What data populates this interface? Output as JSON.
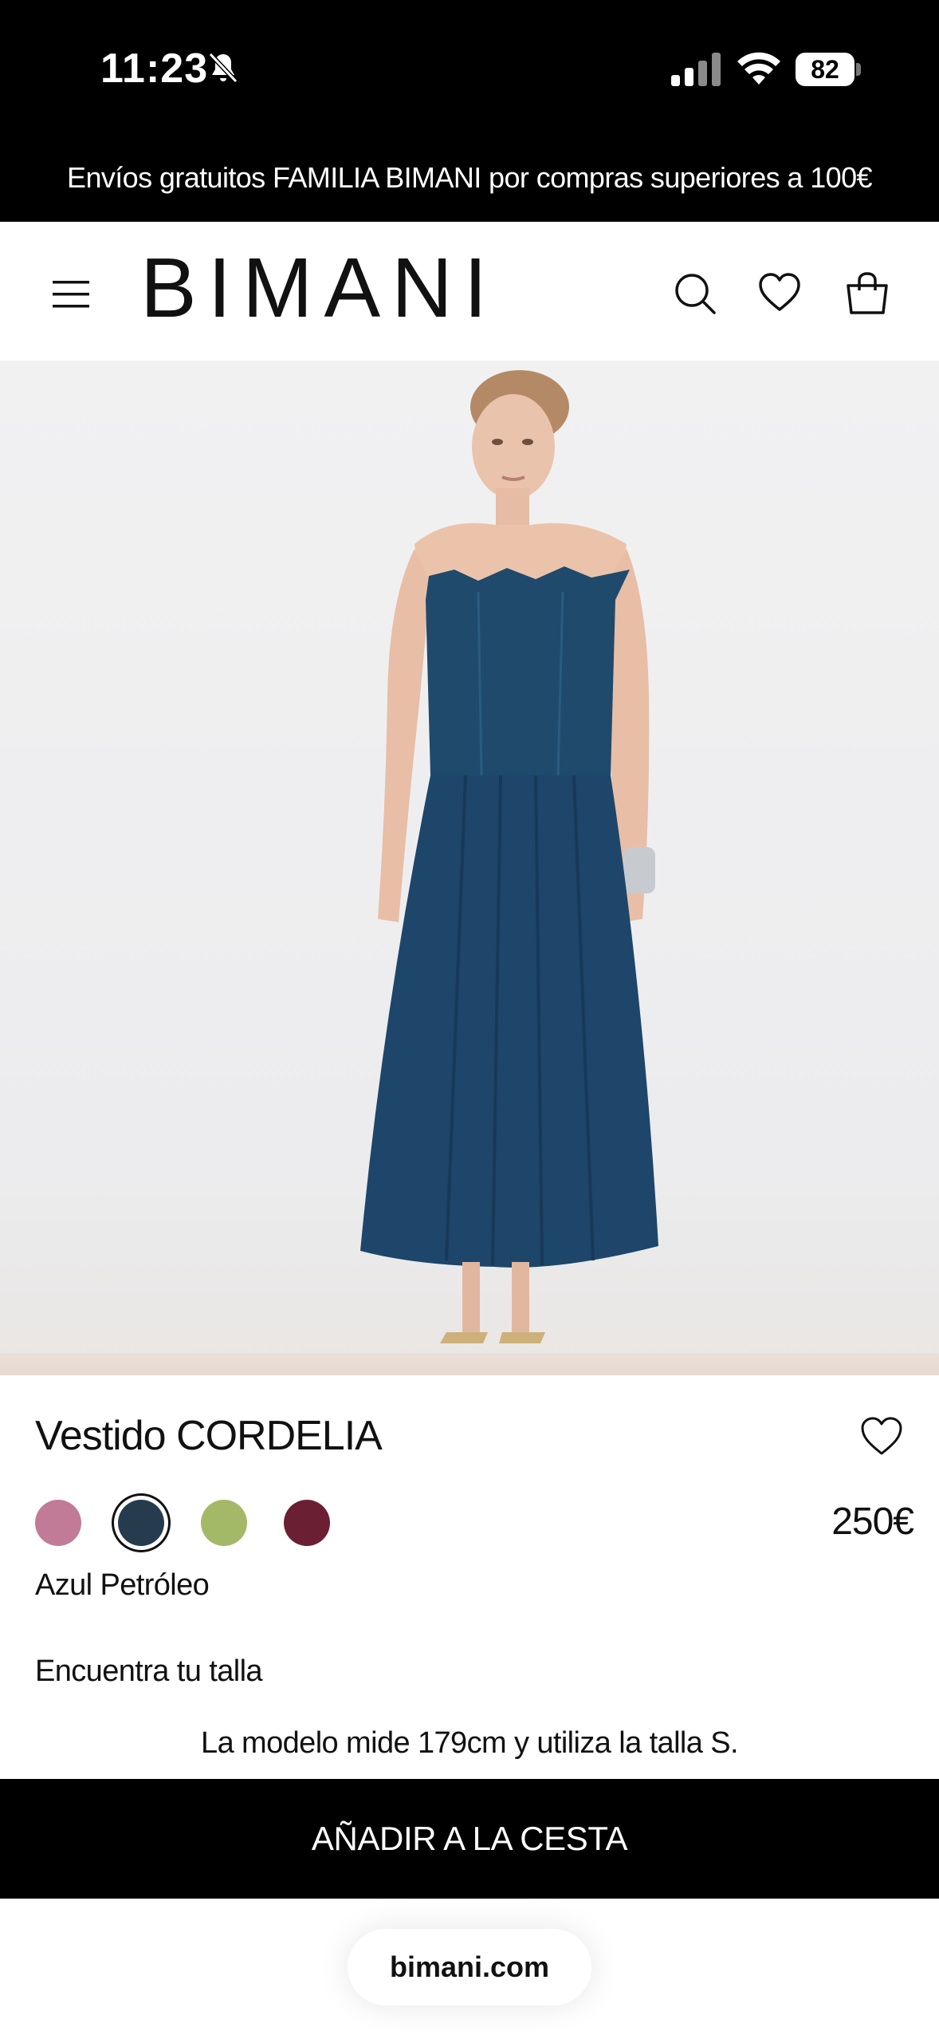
{
  "status_bar": {
    "time": "11:23",
    "battery": "82",
    "icons": [
      "bell-slash-icon",
      "signal-icon",
      "wifi-icon",
      "battery-icon"
    ]
  },
  "promo": {
    "text": "Envíos gratuitos FAMILIA BIMANI por compras superiores a 100€"
  },
  "header": {
    "logo": "BIMANI",
    "icons": [
      "menu-icon",
      "search-icon",
      "heart-icon",
      "shopping-bag-icon"
    ]
  },
  "product": {
    "title": "Vestido CORDELIA",
    "price": "250€",
    "selected_color": "Azul Petróleo",
    "swatches": [
      {
        "color": "#c27b97",
        "selected": false
      },
      {
        "color": "#263c4e",
        "selected": true
      },
      {
        "color": "#a4b968",
        "selected": false
      },
      {
        "color": "#6b1f33",
        "selected": false
      }
    ],
    "size_finder": "Encuentra tu talla",
    "model_info": "La modelo mide 179cm y utiliza la talla S.",
    "dress_color": "#1f4a6b"
  },
  "cart": {
    "add_label": "AÑADIR A LA CESTA"
  },
  "browser": {
    "url": "bimani.com"
  }
}
